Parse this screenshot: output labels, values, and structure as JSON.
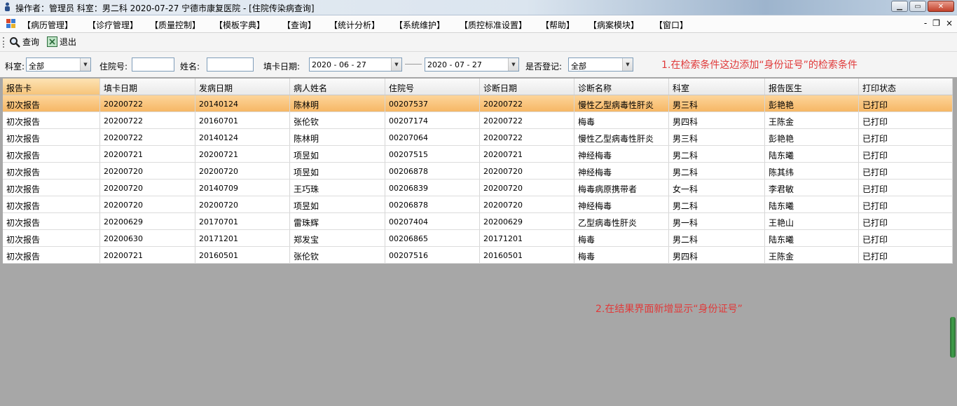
{
  "window": {
    "title": "操作者：管理员  科室：男二科  2020-07-27  宁德市康复医院 - [住院传染病查询]"
  },
  "menu": {
    "items": [
      {
        "label": "【病历管理】"
      },
      {
        "label": "【诊疗管理】"
      },
      {
        "label": "【质量控制】"
      },
      {
        "label": "【模板字典】"
      },
      {
        "label": "【查询】"
      },
      {
        "label": "【统计分析】"
      },
      {
        "label": "【系统维护】"
      },
      {
        "label": "【质控标准设置】"
      },
      {
        "label": "【帮助】"
      },
      {
        "label": "【病案模块】"
      },
      {
        "label": "【窗口】"
      }
    ],
    "mdi_controls": {
      "minimize": "-",
      "restore": "❐",
      "close": "×"
    }
  },
  "toolbar": {
    "query_label": "查询",
    "exit_label": "退出"
  },
  "filters": {
    "dept_label": "科室:",
    "dept_value": "全部",
    "admission_no_label": "住院号:",
    "admission_no_value": "",
    "name_label": "姓名:",
    "name_value": "",
    "fill_date_label": "填卡日期:",
    "date_from": "2020 - 06 - 27",
    "date_to": "2020 - 07 - 27",
    "registered_label": "是否登记:",
    "registered_value": "全部"
  },
  "annotations": {
    "note1": "1.在检索条件这边添加“身份证号”的检索条件",
    "note2": "2.在结果界面新增显示“身份证号”"
  },
  "table": {
    "columns": [
      "报告卡",
      "填卡日期",
      "发病日期",
      "病人姓名",
      "住院号",
      "诊断日期",
      "诊断名称",
      "科室",
      "报告医生",
      "打印状态"
    ],
    "selected_row": 0,
    "rows": [
      [
        "初次报告",
        "20200722",
        "20140124",
        "陈林明",
        "00207537",
        "20200722",
        "慢性乙型病毒性肝炎",
        "男三科",
        "彭艳艳",
        "已打印"
      ],
      [
        "初次报告",
        "20200722",
        "20160701",
        "张伦钦",
        "00207174",
        "20200722",
        "梅毒",
        "男四科",
        "王陈金",
        "已打印"
      ],
      [
        "初次报告",
        "20200722",
        "20140124",
        "陈林明",
        "00207064",
        "20200722",
        "慢性乙型病毒性肝炎",
        "男三科",
        "彭艳艳",
        "已打印"
      ],
      [
        "初次报告",
        "20200721",
        "20200721",
        "项昱如",
        "00207515",
        "20200721",
        "神经梅毒",
        "男二科",
        "陆东曦",
        "已打印"
      ],
      [
        "初次报告",
        "20200720",
        "20200720",
        "项昱如",
        "00206878",
        "20200720",
        "神经梅毒",
        "男二科",
        "陈其纬",
        "已打印"
      ],
      [
        "初次报告",
        "20200720",
        "20140709",
        "王巧珠",
        "00206839",
        "20200720",
        "梅毒病原携带者",
        "女一科",
        "李君敏",
        "已打印"
      ],
      [
        "初次报告",
        "20200720",
        "20200720",
        "项昱如",
        "00206878",
        "20200720",
        "神经梅毒",
        "男二科",
        "陆东曦",
        "已打印"
      ],
      [
        "初次报告",
        "20200629",
        "20170701",
        "雷珠辉",
        "00207404",
        "20200629",
        "乙型病毒性肝炎",
        "男一科",
        "王艳山",
        "已打印"
      ],
      [
        "初次报告",
        "20200630",
        "20171201",
        "郑发宝",
        "00206865",
        "20171201",
        "梅毒",
        "男二科",
        "陆东曦",
        "已打印"
      ],
      [
        "初次报告",
        "20200721",
        "20160501",
        "张伦钦",
        "00207516",
        "20160501",
        "梅毒",
        "男四科",
        "王陈金",
        "已打印"
      ]
    ]
  }
}
